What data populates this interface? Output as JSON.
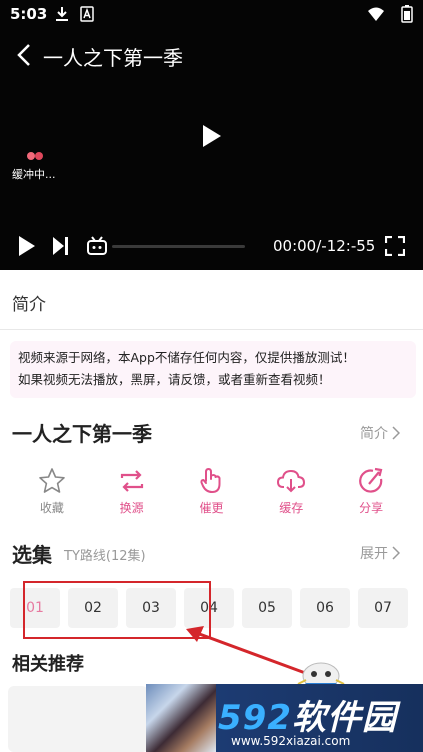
{
  "status_bar": {
    "time": "5:03"
  },
  "player": {
    "title": "一人之下第一季",
    "buffer_text": "缓冲中...",
    "time_display": "00:00/-12:-55"
  },
  "intro_tab": "简介",
  "notice": {
    "line1": "视频来源于网络，本App不储存任何内容，仅提供播放测试！",
    "line2": "如果视频无法播放，黑屏，请反馈，或者重新查看视频！"
  },
  "show": {
    "title": "一人之下第一季",
    "intro_link": "简介"
  },
  "actions": [
    {
      "label": "收藏",
      "icon": "star-icon",
      "color": "#888888"
    },
    {
      "label": "换源",
      "icon": "switch-source-icon",
      "color": "#e0508a"
    },
    {
      "label": "催更",
      "icon": "urge-update-icon",
      "color": "#e0508a"
    },
    {
      "label": "缓存",
      "icon": "cloud-download-icon",
      "color": "#e0508a"
    },
    {
      "label": "分享",
      "icon": "share-icon",
      "color": "#e0508a"
    }
  ],
  "episodes": {
    "title": "选集",
    "route": "TY路线(12集)",
    "expand": "展开",
    "items": [
      "01",
      "02",
      "03",
      "04",
      "05",
      "06",
      "07"
    ]
  },
  "recommend": {
    "title": "相关推荐"
  },
  "watermark": {
    "brand_num": "592",
    "brand_cn": "软件园",
    "site": "www.592xiazai.com"
  },
  "colors": {
    "accent": "#e0508a",
    "highlight": "#d4262b"
  }
}
